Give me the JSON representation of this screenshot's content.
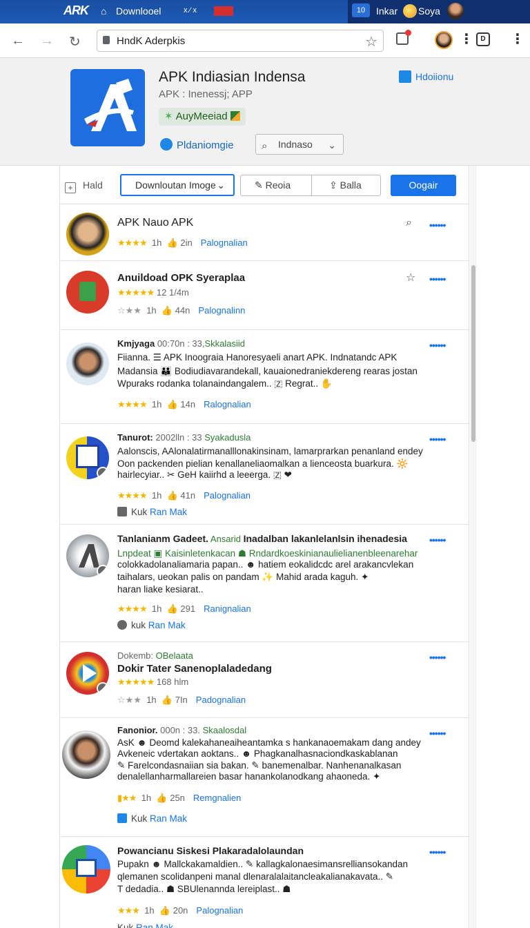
{
  "osbar": {
    "logo": "ARK",
    "home_icon": "home-icon",
    "download_label": "Downlooel",
    "marks": "x ⁄ x",
    "flag_label": "",
    "chip_label": "10",
    "label_1": "Inkar",
    "label_2": "Soya"
  },
  "browser": {
    "back": "←",
    "forward": "→",
    "reload": "↻",
    "url": "HndK Aderpkis",
    "star": "☆",
    "menu": "⋮",
    "dbox": "D"
  },
  "header": {
    "title": "APK Indiasian Indensa",
    "subtitle": "APK :  Inenessj;  APP",
    "badge": "AuyMeeiad",
    "platform": "Pldaniomgie",
    "search_value": "Indnaso",
    "link": "Hdoiionu"
  },
  "toolbar": {
    "hold": "Hald",
    "download_select": "Downloutan Imoge",
    "review": "Reoia",
    "share": "Balla",
    "primary": "Oogair"
  },
  "items": [
    {
      "title": "APK Nauo APK",
      "meta_stars": "★★★★",
      "meta_a": "1h",
      "meta_b": "2in",
      "link": "Palognalian"
    },
    {
      "title": "Anuildoad OPK Syeraplaa",
      "rating_stars": "★★★★★",
      "rating_text": "12 1/4m",
      "meta_stars": "☆★★",
      "meta_a": "1h",
      "meta_b": "44n",
      "link": "Palognalinn"
    },
    {
      "title": "Kmjyaga",
      "title_gray": " 00:70n : 33,",
      "title_green": "Skkalasiid",
      "line1": "Fiianna.  ☰  APK Inoograia Hanoresyaeli anart APK.  Indnatandc APK",
      "line2": "Madansia  👪  Bodiudiavarandekall, kauaionedraniekdereng rearas jostan",
      "line3": "Wpuraks rodanka tolanaindangalem..  🇿  Regrat..  ✋",
      "meta_stars": "★★★★",
      "meta_a": "1h",
      "meta_b": "14n",
      "link": "Ralognalian"
    },
    {
      "title": "Tanurot:",
      "title_gray": " 2002lln : 33 ",
      "title_green": "Syakadusla",
      "line1": "Aalonscis, AAlonalatirmanalllonakinsinam, lamarprarkan penanland endey",
      "line2": "Oon packenden pielian kenallaneliaomalkan a lienceosta buarkura.  🔆",
      "line3": "hairlecyiar..  ✂  GeH kaiirhd a leeerga.  🇿  ❤",
      "meta_stars": "★★★★",
      "meta_a": "1h",
      "meta_b": "41n",
      "link": "Palognalian",
      "extra_a": "Kuk",
      "extra_link": "Ran Mak"
    },
    {
      "title": "Tanlanianm Gadeet.",
      "title_green": " Ansarid ",
      "title_rest": "Inadalban lakanlelanlsin ihenadesia",
      "line1": "Lnpdeat  ▣  Kaisinletenkacan  ☗  Rndardkoeskinianaulielianenbleenarehar",
      "line2": "colokkadolanaliamaria papan..  ☻  hatiem eokalidcdc arel arakancvlekan",
      "line3": "taihalars, ueokan palis on pandam  ✨  Mahid arada kaguh.  ✦",
      "line4": "haran liake kesiarat..",
      "meta_stars": "★★★★",
      "meta_a": "1h",
      "meta_b": "291",
      "link": "Ranignalian",
      "extra_a": "kuk",
      "extra_link": "Ran Mak"
    },
    {
      "title_gray_top": "Dokemb:",
      "title_green_top": " OBelaata",
      "title": "Dokir Tater Sanenoplaladedang",
      "rating_stars": "★★★★★",
      "rating_text": "168 hlm",
      "meta_stars": "☆★★",
      "meta_a": "1h",
      "meta_b": "7In",
      "link": "Padognalian"
    },
    {
      "title": "Fanonior.",
      "title_gray": " 000n : 33. ",
      "title_green": "Skaalosdal",
      "line1": "AsK   ☻  Deomd kalekahaneaiheantamka s hankanaoemakam dang andey",
      "line2": "Avkeneic vdertakan aoktans..  ☻  Phagkanalhasnaciondkaskablanan",
      "line3": "✎ Farelcondasnaiian sia bakan.  ✎  banemenalbar. Nanhenanalkasan",
      "line4": "denalellanharmallareien basar hanankolanodkang ahaoneda.  ✦",
      "meta_stars": "▮★★",
      "meta_a": "1h",
      "meta_b": "25n",
      "link": "Remgnalien",
      "extra_a": "Kuk",
      "extra_link": "Ran Mak"
    },
    {
      "title": "Powancianu Siskesi Plakaradalolaundan",
      "line1": "Pupakn  ☻  Mallckakamaldien..  ✎  kallagkalonaesimansrelliansokandan",
      "line2": "qlemanen scolidanpeni manal dlenaralalaitancleakalianakavata..  ✎",
      "line3": "T dedadia..  ☗  SBUlenannda lereiplast..  ☗",
      "meta_stars": "★★★",
      "meta_a": "1h",
      "meta_b": "20n",
      "link": "Palognalian",
      "extra_a": "Kuk",
      "extra_link": "Ran Mak"
    }
  ],
  "icons": {
    "more": "••••••",
    "search": "⌕",
    "star_outline": "☆",
    "thumb": "👍"
  },
  "colors": {
    "accent": "#1a73e8",
    "topbar": "#1e5ab5",
    "star": "#f2b600",
    "green": "#2e7d32"
  }
}
